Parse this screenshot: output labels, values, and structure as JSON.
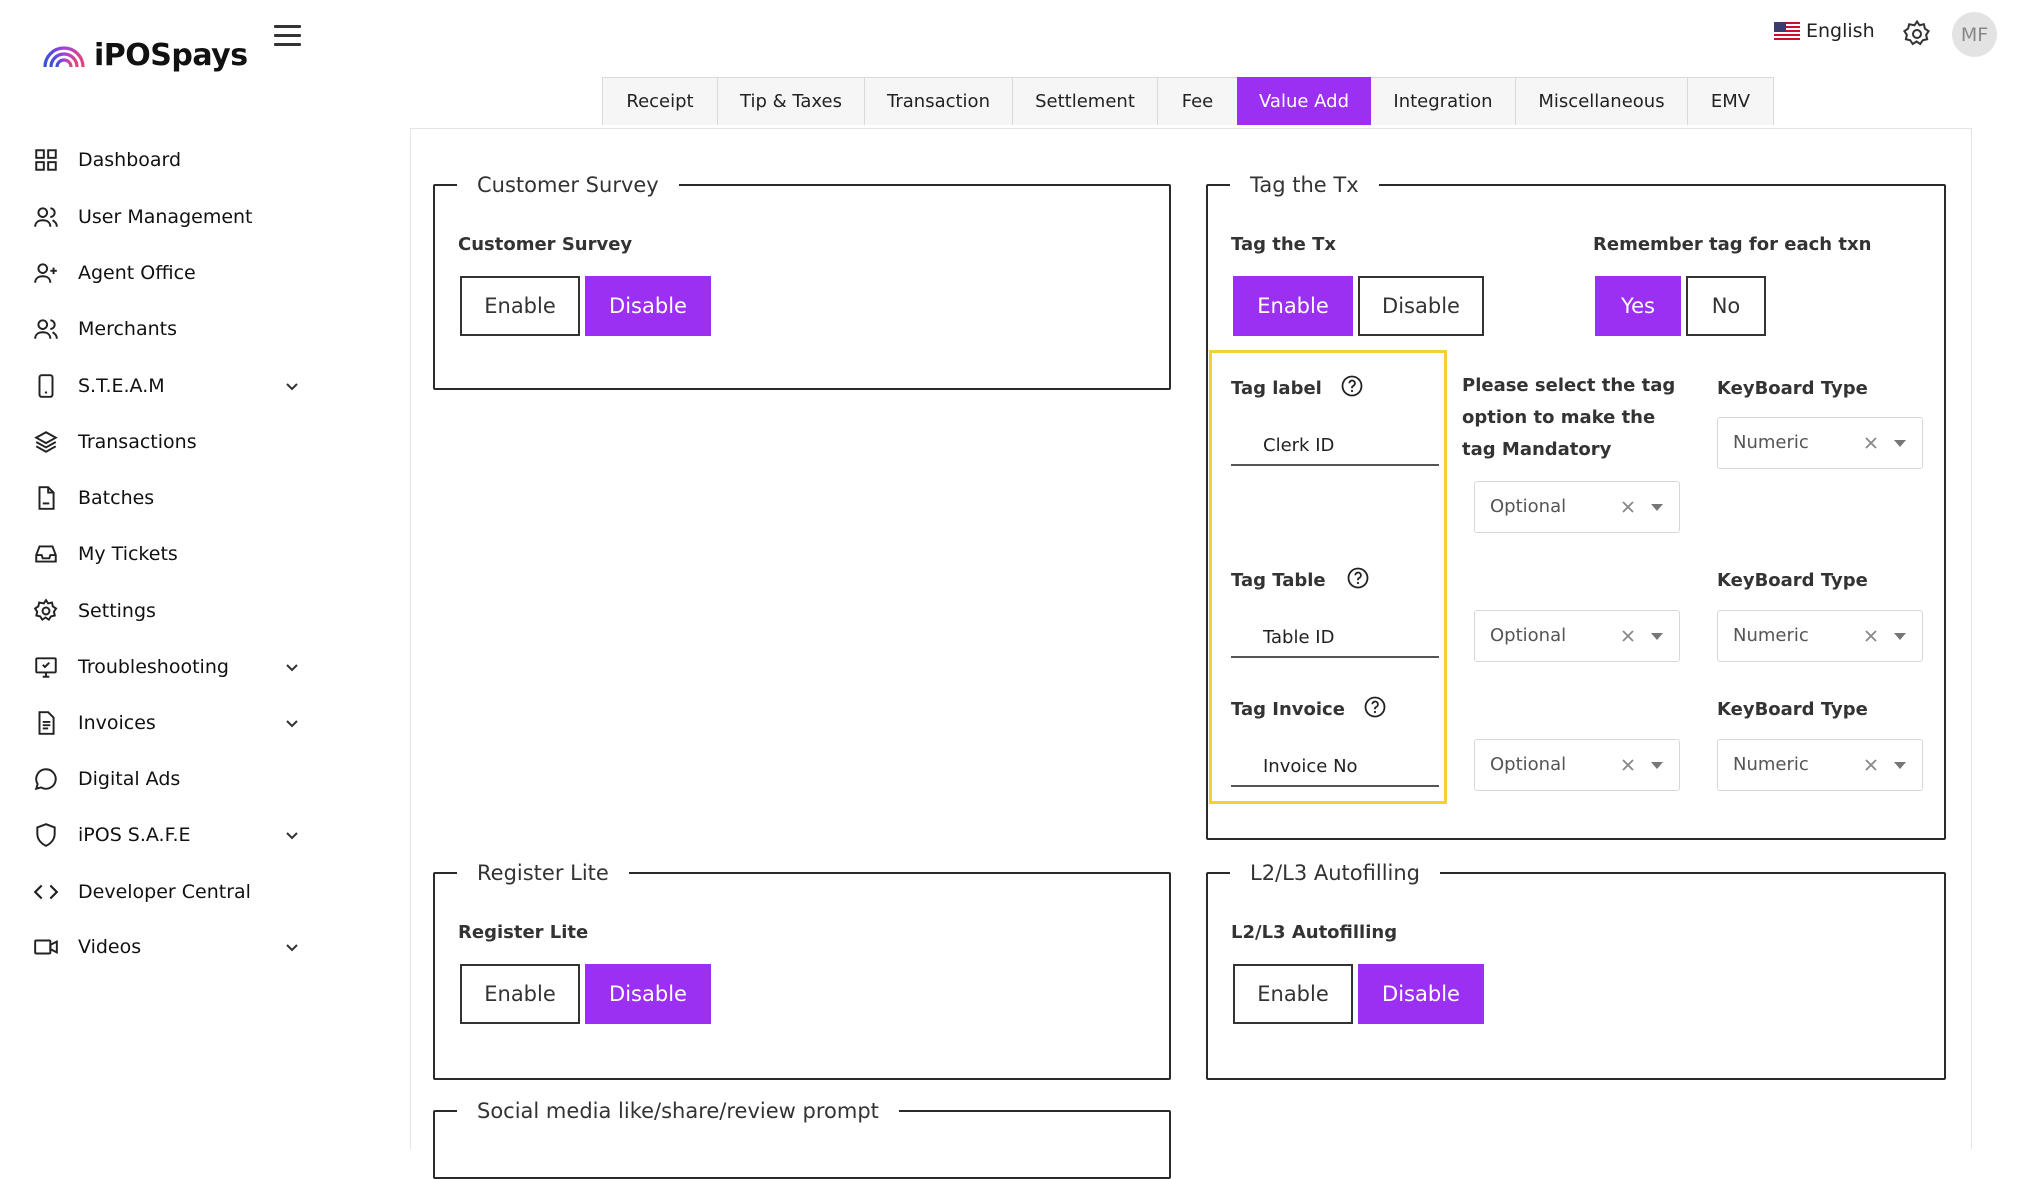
{
  "app": {
    "logo_text": "iPOSpays"
  },
  "sidebar": {
    "items": [
      {
        "label": "Dashboard",
        "icon": "dashboard-icon"
      },
      {
        "label": "User Management",
        "icon": "users-icon"
      },
      {
        "label": "Agent Office",
        "icon": "user-plus-icon"
      },
      {
        "label": "Merchants",
        "icon": "users-icon"
      },
      {
        "label": "S.T.E.A.M",
        "icon": "phone-icon",
        "expandable": true
      },
      {
        "label": "Transactions",
        "icon": "layers-icon"
      },
      {
        "label": "Batches",
        "icon": "document-icon"
      },
      {
        "label": "My Tickets",
        "icon": "inbox-icon"
      },
      {
        "label": "Settings",
        "icon": "gear-icon"
      },
      {
        "label": "Troubleshooting",
        "icon": "monitor-icon",
        "expandable": true
      },
      {
        "label": "Invoices",
        "icon": "invoice-icon",
        "expandable": true
      },
      {
        "label": "Digital Ads",
        "icon": "chat-icon"
      },
      {
        "label": "iPOS S.A.F.E",
        "icon": "shield-icon",
        "expandable": true
      },
      {
        "label": "Developer Central",
        "icon": "code-icon"
      },
      {
        "label": "Videos",
        "icon": "video-icon",
        "expandable": true
      }
    ]
  },
  "topbar": {
    "language": "English",
    "avatar_initials": "MF"
  },
  "tabs": [
    {
      "label": "Receipt"
    },
    {
      "label": "Tip & Taxes"
    },
    {
      "label": "Transaction"
    },
    {
      "label": "Settlement"
    },
    {
      "label": "Fee"
    },
    {
      "label": "Value Add",
      "active": true
    },
    {
      "label": "Integration"
    },
    {
      "label": "Miscellaneous"
    },
    {
      "label": "EMV"
    }
  ],
  "customer_survey": {
    "legend": "Customer Survey",
    "label": "Customer Survey",
    "enable": "Enable",
    "disable": "Disable",
    "selected": "Disable"
  },
  "tag_tx": {
    "legend": "Tag the Tx",
    "label": "Tag the Tx",
    "enable": "Enable",
    "disable": "Disable",
    "selected": "Enable",
    "remember_label": "Remember tag for each txn",
    "yes": "Yes",
    "no": "No",
    "remember_selected": "Yes",
    "mandatory_text": "Please select the tag option to make the tag Mandatory",
    "rows": [
      {
        "label": "Tag label",
        "value": "Clerk ID",
        "option": "Optional",
        "keyboard_label": "KeyBoard Type",
        "keyboard": "Numeric"
      },
      {
        "label": "Tag Table",
        "value": "Table ID",
        "option": "Optional",
        "keyboard_label": "KeyBoard Type",
        "keyboard": "Numeric"
      },
      {
        "label": "Tag Invoice",
        "value": "Invoice No",
        "option": "Optional",
        "keyboard_label": "KeyBoard Type",
        "keyboard": "Numeric"
      }
    ]
  },
  "register_lite": {
    "legend": "Register Lite",
    "label": "Register Lite",
    "enable": "Enable",
    "disable": "Disable",
    "selected": "Disable"
  },
  "l2l3": {
    "legend": "L2/L3 Autofilling",
    "label": "L2/L3 Autofilling",
    "enable": "Enable",
    "disable": "Disable",
    "selected": "Disable"
  },
  "social": {
    "legend": "Social media like/share/review prompt"
  },
  "colors": {
    "accent": "#9b30f2",
    "highlight": "#f3cf3c",
    "logo_gradient": [
      "#3b4fd8",
      "#a13fe0",
      "#e0457b"
    ]
  }
}
